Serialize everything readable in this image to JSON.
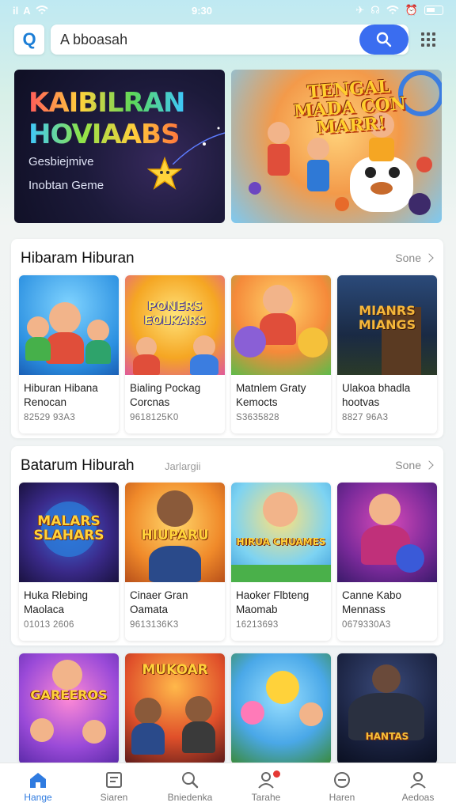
{
  "status_bar": {
    "time": "9:30",
    "signal": "il",
    "carrier": "A"
  },
  "search": {
    "logo": "Q",
    "value": "A bboasah"
  },
  "banners": {
    "left": {
      "line1": "KAIBILRAN",
      "line2": "HOVIAABS",
      "sub1": "Gesbiejmive",
      "sub2": "Inobtan Geme"
    },
    "right": {
      "title": "TENGAL MADA CON MARR!"
    }
  },
  "sections": [
    {
      "title": "Hibaram Hiburan",
      "tag": "",
      "more": "Sone",
      "cards": [
        {
          "name": "Hiburan Hibana Renocan",
          "num": "82529 93A3",
          "label": ""
        },
        {
          "name": "Bialing Pockag Corcnas",
          "num": "9618125K0",
          "label": "PONERS EOLKARS"
        },
        {
          "name": "Matnlem Graty Kemocts",
          "num": "S3635828",
          "label": ""
        },
        {
          "name": "Ulakoa bhadla hootvas",
          "num": "8827 96A3",
          "label": "MIANRS MIANGS"
        }
      ]
    },
    {
      "title": "Batarum Hiburah",
      "tag": "Jarlargii",
      "more": "Sone",
      "cards": [
        {
          "name": "Huka Rlebing Maolaca",
          "num": "01013 2606",
          "label": "MALARS SLAHARS"
        },
        {
          "name": "Cinaer Gran Oamata",
          "num": "9613136K3",
          "label": "HIUPARU"
        },
        {
          "name": "Haoker Flbteng Maomab",
          "num": "16213693",
          "label": "HIRUA CHUAMES"
        },
        {
          "name": "Canne Kabo Mennass",
          "num": "0679330A3",
          "label": ""
        }
      ]
    },
    {
      "cards": [
        {
          "label": "GAREEROS"
        },
        {
          "label": "MUKOAR"
        },
        {
          "label": ""
        },
        {
          "label": "HANTAS"
        }
      ]
    }
  ],
  "nav": [
    {
      "label": "Hange",
      "icon": "home-icon",
      "active": true
    },
    {
      "label": "Siaren",
      "icon": "list-icon"
    },
    {
      "label": "Bniedenka",
      "icon": "search-icon"
    },
    {
      "label": "Tarahe",
      "icon": "profile-badge-icon"
    },
    {
      "label": "Haren",
      "icon": "gamepad-icon"
    },
    {
      "label": "Aedoas",
      "icon": "user-icon"
    }
  ],
  "colors": {
    "accent": "#3a6df0",
    "active_nav": "#2f7be0"
  }
}
